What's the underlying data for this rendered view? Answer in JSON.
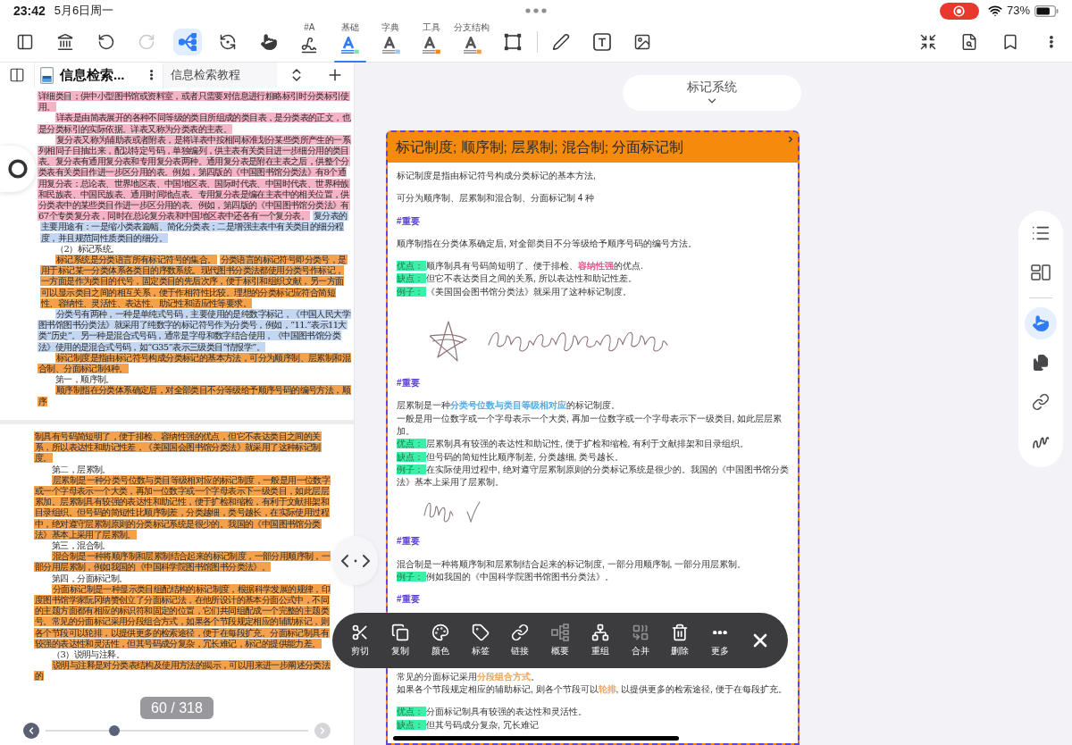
{
  "status_bar": {
    "time": "23:42",
    "date": "5月6日周一",
    "battery": "73%"
  },
  "toolbar": {
    "tools": [
      {
        "kind": "sidebar",
        "selected": false,
        "disabled": false
      },
      {
        "kind": "library",
        "selected": false,
        "disabled": false
      },
      {
        "kind": "undo",
        "selected": false,
        "disabled": false
      },
      {
        "kind": "redo",
        "selected": false,
        "disabled": true
      },
      {
        "kind": "mindmap",
        "selected": true,
        "disabled": false
      },
      {
        "kind": "sync",
        "selected": false,
        "disabled": false
      },
      {
        "kind": "pointer",
        "selected": false,
        "disabled": false
      },
      {
        "kind": "signature",
        "label": "#A",
        "selected": false,
        "disabled": false
      },
      {
        "kind": "letter",
        "label": "基础",
        "color": "#86e3a6",
        "selected": true,
        "disabled": false
      },
      {
        "kind": "letter",
        "label": "字典",
        "color": "#9cc8ef",
        "selected": false,
        "disabled": false
      },
      {
        "kind": "letter",
        "label": "工具",
        "color": "#f5841f",
        "selected": false,
        "disabled": false
      },
      {
        "kind": "letter",
        "label": "分支结构",
        "color": "#f59e3a",
        "selected": false,
        "disabled": false
      },
      {
        "kind": "frame",
        "selected": false,
        "disabled": false
      }
    ],
    "draw_tools": [
      {
        "kind": "pen",
        "selected": false,
        "disabled": false
      },
      {
        "kind": "textbox",
        "selected": false,
        "disabled": false
      },
      {
        "kind": "image",
        "selected": false,
        "disabled": false
      }
    ],
    "actions": [
      {
        "kind": "collapse"
      },
      {
        "kind": "search"
      },
      {
        "kind": "bookmark"
      },
      {
        "kind": "more"
      }
    ]
  },
  "reader": {
    "tabs": [
      {
        "title": "信息检索...",
        "selected": true
      },
      {
        "title": "信息检索教程",
        "selected": false
      }
    ],
    "pages": [
      {
        "paragraphs": [
          {
            "indent": false,
            "segments": [
              {
                "text": "详细类目；供中小型图书馆或资料室，或者只需要对信息进行粗略标引时分类标引使用。",
                "color": "#f5b3c6"
              }
            ]
          },
          {
            "indent": true,
            "segments": [
              {
                "text": "详表是由简表展开的各种不同等级的类目所组成的类目表，是分类表的正文，也是分类标引的实际依据。详表又称为分类表的主表。",
                "color": "#f5b3c6"
              }
            ]
          },
          {
            "indent": true,
            "segments": [
              {
                "text": "复分表又称为辅助表或者附表，是将详表中按相同标准划分某些类所产生的一系列相同子目抽出来，配以特定号码，单独编列，供主表有关类目进一步细分用的类目表。复分表有通用复分表和专用复分表两种。通用复分表是附在主表之后，供整个分类表有关类目作进一步区分用的表。例如，第四版的《中国图书馆分类法》有8个通用复分表：总论表、世界地区表、中国地区表、国际时代表、中国时代表、世界种族和民族表、中国民族表、通用时间地点表。专用复分表是编在主表中的相关位置，供分类表中的某些类目作进一步区分用的表。例如，第四版的《中国图书馆分类法》有67个专类复分表，同时在总论复分表和中国地区表中还各有一个复分表。",
                "color": "#f5b3c6"
              },
              {
                "text": "复分表的主要用途有：一是缩小类表篇幅、简化分类表；二是增强主表中有关类目的细分程度，并且规范同性质类目的细分。",
                "color": "#c3d7f2"
              }
            ]
          },
          {
            "indent": true,
            "segments": [
              {
                "text": "（2）标记系统。"
              }
            ]
          },
          {
            "indent": true,
            "segments": [
              {
                "text": "标记系统是分类语言所有标记符号的集合。",
                "color": "#f5a04a"
              },
              {
                "text": "分类语言的标记符号即分类号，是用于标记某一分类体系各类目的序数系统。现代图书分类法都使用分类号作标记，一方面是作为类目的代号，固定类目的先后次序，便于标引和组织文献，另一方面可以显示类目之间的相互关系，便于作相符性比较。理想的分类标记应符合简短性、容纳性、灵活性、表达性、助记性和适应性等要求。",
                "color": "#f5a04a"
              }
            ]
          },
          {
            "indent": true,
            "segments": [
              {
                "text": "分类号有两种，一种是单纯式号码，主要使用的是纯数字标记，《中国人民大学图书馆图书分类法》就采用了纯数字的标记符号作为分类号，例如，“11.”表示11大类“历史”。另一种是混合式号码，通常是字母和数字结合使用，《中国图书馆分类法》使用的是混合式号码，如“G35”表示三级类目“情报学”。",
                "color": "#c3d7f2"
              }
            ]
          },
          {
            "indent": true,
            "segments": [
              {
                "text": "标记制度是指由标记符号构成分类标记的基本方法，可分为顺序制、层累制和混合制、分面标记制4种。",
                "color": "#f5a04a"
              }
            ]
          },
          {
            "indent": true,
            "segments": [
              {
                "text": "第一，顺序制。"
              }
            ]
          },
          {
            "indent": true,
            "segments": [
              {
                "text": "顺序制指在分类体系确定后，对全部类目不分等级给予顺序号码的编号方法，顺序",
                "color": "#f5a04a"
              }
            ]
          }
        ]
      },
      {
        "paragraphs": [
          {
            "indent": false,
            "segments": [
              {
                "text": "制具有号码简短明了，便于排检、容纳性强的优点，但它不表达类目之间的关系，所以表达性和助记性差，《美国国会图书馆分类法》就采用了这种标记制度。",
                "color": "#f5a04a"
              }
            ]
          },
          {
            "indent": true,
            "segments": [
              {
                "text": "第二，层累制。"
              }
            ]
          },
          {
            "indent": true,
            "segments": [
              {
                "text": "层累制是一种分类号位数与类目等级相对应的标记制度，一般是用一位数字或一个字母表示一个大类，再加一位数字或一个字母表示下一级类目，如此层层累加。层累制具有较强的表达性和助记性，便于扩检和缩检，有利于文献排架和目录组织。但号码的简短性比顺序制差，分类越细，类号越长，在实际使用过程中，绝对遵守层累制原则的分类标记系统是很少的。我国的《中国图书馆分类法》基本上采用了层累制。",
                "color": "#f5a04a"
              }
            ]
          },
          {
            "indent": true,
            "segments": [
              {
                "text": "第三，混合制。"
              }
            ]
          },
          {
            "indent": true,
            "segments": [
              {
                "text": "混合制是一种将顺序制和层累制结合起来的标记制度，一部分用顺序制，一部分用层累制，例如我国的《中国科学院图书馆图书分类法》。",
                "color": "#f5a04a"
              }
            ]
          },
          {
            "indent": true,
            "segments": [
              {
                "text": "第四，分面标记制。"
              }
            ]
          },
          {
            "indent": true,
            "segments": [
              {
                "text": "分面标记制是一种显示类目组配结构的标记制度，根据科学发展的规律，印度图书馆学家阮冈纳赞创立了分面标记法，在他所设计的基本分面公式中，不同的主题方面都有相应的标识符和固定的位置，它们共同组配成一个完整的主题类号。常见的分面标记采用分段组合方式，如果各个节段规定相应的辅助标记，则各个节段可以轮排，以提供更多的检索途径，便于在每段扩充。分面标记制具有较强的表达性和灵活性，但其号码成分复杂，冗长难记，标记的提供能力差。",
                "color": "#f5a04a"
              }
            ]
          },
          {
            "indent": true,
            "segments": [
              {
                "text": "（3）说明与注释。"
              }
            ]
          },
          {
            "indent": true,
            "segments": [
              {
                "text": "说明与注释是对分类表结构及使用方法的揭示，可以用来进一步阐述分类法的",
                "color": "#f5a04a"
              }
            ]
          }
        ]
      }
    ],
    "page_indicator": "60 / 318",
    "page_slider": {
      "level": 0.25
    }
  },
  "branch_title": "标记系统",
  "card": {
    "title": "标记制度; 顺序制; 层累制; 混合制; 分面标记制",
    "sections": [
      {
        "items": [
          {
            "kind": "text",
            "segments": [
              {
                "text": "标记制度是指由标记符号构成分类标记的基本方法,"
              }
            ]
          }
        ]
      },
      {
        "items": [
          {
            "kind": "text",
            "segments": [
              {
                "text": "可分为顺序制、层累制和混合制、分面标记制 4 种"
              }
            ]
          }
        ]
      },
      {
        "items": [
          {
            "kind": "tag",
            "text": "#重要"
          }
        ]
      },
      {
        "items": [
          {
            "kind": "text",
            "segments": [
              {
                "text": "顺序制指在分类体系确定后, 对全部类目不分等级给予顺序号码的编号方法。"
              }
            ]
          }
        ]
      },
      {
        "items": [
          {
            "kind": "labeled",
            "label": "优点：",
            "segments": [
              {
                "text": "顺序制具有号码简短明了、便于排检、"
              },
              {
                "text": "容纳性强",
                "color": "#e8508a"
              },
              {
                "text": "的优点."
              }
            ]
          },
          {
            "kind": "labeled",
            "label": "缺点：",
            "segments": [
              {
                "text": "但它不表达类目之间的关系, 所以表达性和助记性差。"
              }
            ]
          },
          {
            "kind": "labeled",
            "label": "例子：",
            "segments": [
              {
                "text": "《美国国会图书馆分类法》就采用了这种标记制度。"
              }
            ]
          }
        ]
      },
      {
        "items": [
          {
            "kind": "doodle"
          }
        ]
      },
      {
        "items": [
          {
            "kind": "tag",
            "text": "#重要"
          }
        ]
      },
      {
        "items": [
          {
            "kind": "text",
            "segments": [
              {
                "text": "层累制是一种"
              },
              {
                "text": "分类号位数与类目等级相对应",
                "color": "#4aa8e8"
              },
              {
                "text": "的标记制度。"
              }
            ]
          },
          {
            "kind": "text",
            "segments": [
              {
                "text": "一般是用一位数字或一个字母表示一个大类, 再加一位数字或一个字母表示下一级类目, 如此层层累加。"
              }
            ]
          },
          {
            "kind": "labeled",
            "label": "优点：",
            "segments": [
              {
                "text": "层累制具有较强的表达性和助记性, 便于扩检和缩检, 有利于文献排架和目录组织。"
              }
            ]
          },
          {
            "kind": "labeled",
            "label": "缺点：",
            "segments": [
              {
                "text": "但号码的简短性比顺序制差, 分类越细, 类号越长。"
              }
            ]
          },
          {
            "kind": "labeled",
            "label": "例子：",
            "segments": [
              {
                "text": "在实际使用过程中, 绝对遵守层累制原则的分类标记系统是很少的。我国的《中国图书馆分类法》基本上采用了层累制。"
              }
            ]
          }
        ]
      },
      {
        "items": [
          {
            "kind": "tick"
          }
        ]
      },
      {
        "items": [
          {
            "kind": "tag",
            "text": "#重要"
          }
        ]
      },
      {
        "items": [
          {
            "kind": "text",
            "segments": [
              {
                "text": "混合制是一种将顺序制和层累制结合起来的标记制度, 一部分用顺序制, 一部分用层累制。"
              }
            ]
          },
          {
            "kind": "labeled",
            "label": "例子：",
            "segments": [
              {
                "text": "例如我国的《中国科学院图书馆图书分类法》。"
              }
            ]
          }
        ]
      },
      {
        "items": [
          {
            "kind": "tag",
            "text": "#重要"
          }
        ]
      },
      {
        "items": [
          {
            "kind": "menu",
            "items": [
              {
                "kind": "cut",
                "label": "剪切",
                "disabled": false
              },
              {
                "kind": "copy",
                "label": "复制",
                "disabled": false
              },
              {
                "kind": "color",
                "label": "颜色",
                "disabled": false
              },
              {
                "kind": "tag",
                "label": "标签",
                "disabled": false
              },
              {
                "kind": "link",
                "label": "链接",
                "disabled": false
              },
              {
                "kind": "summary",
                "label": "概要",
                "disabled": true
              },
              {
                "kind": "regroup",
                "label": "重组",
                "disabled": false
              },
              {
                "kind": "merge",
                "label": "合并",
                "disabled": true
              },
              {
                "kind": "delete",
                "label": "删除",
                "disabled": false
              },
              {
                "kind": "more",
                "label": "更多",
                "disabled": false
              },
              {
                "kind": "close",
                "disabled": false
              }
            ]
          }
        ]
      },
      {
        "items": [
          {
            "kind": "text",
            "segments": [
              {
                "text": "常见的分面标记采用"
              },
              {
                "text": "分段组合方式",
                "color": "#f2a24e"
              },
              {
                "text": "。"
              }
            ]
          },
          {
            "kind": "text",
            "segments": [
              {
                "text": "如果各个节段规定相应的辅助标记, 则各个节段可以"
              },
              {
                "text": "轮排",
                "color": "#f2a24e"
              },
              {
                "text": ", 以提供更多的检索途径, 便于在每段扩充。"
              }
            ]
          }
        ]
      },
      {
        "items": [
          {
            "kind": "labeled",
            "label": "优点：",
            "segments": [
              {
                "text": "分面标记制具有较强的表达性和灵活性。"
              }
            ]
          },
          {
            "kind": "labeled",
            "label": "缺点：",
            "segments": [
              {
                "text": "但其号码成分复杂, 冗长难记"
              }
            ]
          }
        ]
      }
    ]
  },
  "side_tools": {
    "views": [
      {
        "kind": "outline",
        "selected": false
      },
      {
        "kind": "layout",
        "selected": false
      }
    ],
    "modes": [
      {
        "kind": "pointer",
        "selected": true
      },
      {
        "kind": "pages",
        "selected": false
      },
      {
        "kind": "link",
        "selected": false
      },
      {
        "kind": "freehand",
        "selected": false
      }
    ]
  }
}
